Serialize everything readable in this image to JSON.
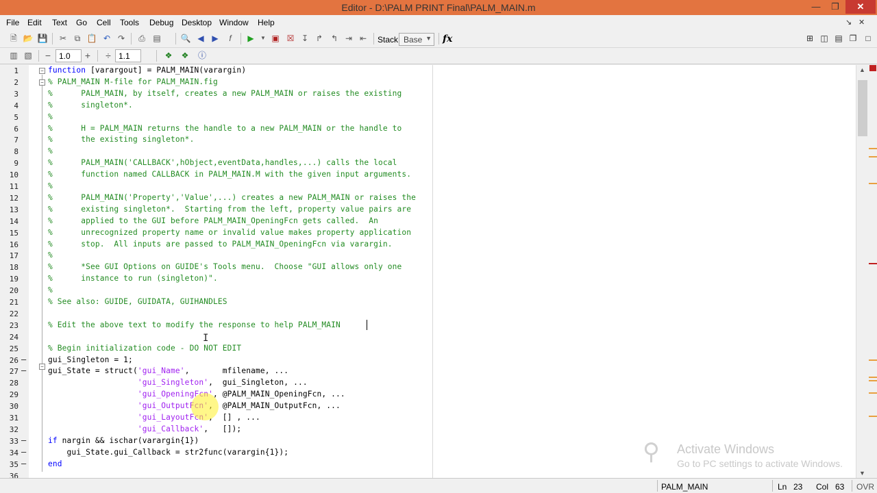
{
  "window": {
    "title": "Editor - D:\\PALM PRINT Final\\PALM_MAIN.m",
    "min_icon": "minimize-icon",
    "max_icon": "restore-icon",
    "close_icon": "close-icon"
  },
  "menubar": {
    "items": [
      "File",
      "Edit",
      "Text",
      "Go",
      "Cell",
      "Tools",
      "Debug",
      "Desktop",
      "Window",
      "Help"
    ]
  },
  "toolbar": {
    "stack_label": "Stack:",
    "stack_value": "Base",
    "fx_label": "fx",
    "cell_minus": "−",
    "cell_value": "1.0",
    "cell_plus": "+",
    "div_symbol": "÷",
    "div_value": "1.1"
  },
  "editor": {
    "lines": [
      {
        "n": "1",
        "dash": "",
        "html": "<span class='k'>function</span> [varargout] = PALM_MAIN(varargin)"
      },
      {
        "n": "2",
        "dash": "",
        "html": "<span class='c'>% PALM_MAIN M-file for PALM_MAIN.fig</span>"
      },
      {
        "n": "3",
        "dash": "",
        "html": "<span class='c'>%      PALM_MAIN, by itself, creates a new PALM_MAIN or raises the existing</span>"
      },
      {
        "n": "4",
        "dash": "",
        "html": "<span class='c'>%      singleton*.</span>"
      },
      {
        "n": "5",
        "dash": "",
        "html": "<span class='c'>%</span>"
      },
      {
        "n": "6",
        "dash": "",
        "html": "<span class='c'>%      H = PALM_MAIN returns the handle to a new PALM_MAIN or the handle to</span>"
      },
      {
        "n": "7",
        "dash": "",
        "html": "<span class='c'>%      the existing singleton*.</span>"
      },
      {
        "n": "8",
        "dash": "",
        "html": "<span class='c'>%</span>"
      },
      {
        "n": "9",
        "dash": "",
        "html": "<span class='c'>%      PALM_MAIN('CALLBACK',hObject,eventData,handles,...) calls the local</span>"
      },
      {
        "n": "10",
        "dash": "",
        "html": "<span class='c'>%      function named CALLBACK in PALM_MAIN.M with the given input arguments.</span>"
      },
      {
        "n": "11",
        "dash": "",
        "html": "<span class='c'>%</span>"
      },
      {
        "n": "12",
        "dash": "",
        "html": "<span class='c'>%      PALM_MAIN('Property','Value',...) creates a new PALM_MAIN or raises the</span>"
      },
      {
        "n": "13",
        "dash": "",
        "html": "<span class='c'>%      existing singleton*.  Starting from the left, property value pairs are</span>"
      },
      {
        "n": "14",
        "dash": "",
        "html": "<span class='c'>%      applied to the GUI before PALM_MAIN_OpeningFcn gets called.  An</span>"
      },
      {
        "n": "15",
        "dash": "",
        "html": "<span class='c'>%      unrecognized property name or invalid value makes property application</span>"
      },
      {
        "n": "16",
        "dash": "",
        "html": "<span class='c'>%      stop.  All inputs are passed to PALM_MAIN_OpeningFcn via varargin.</span>"
      },
      {
        "n": "17",
        "dash": "",
        "html": "<span class='c'>%</span>"
      },
      {
        "n": "18",
        "dash": "",
        "html": "<span class='c'>%      *See GUI Options on GUIDE's Tools menu.  Choose \"GUI allows only one</span>"
      },
      {
        "n": "19",
        "dash": "",
        "html": "<span class='c'>%      instance to run (singleton)\".</span>"
      },
      {
        "n": "20",
        "dash": "",
        "html": "<span class='c'>%</span>"
      },
      {
        "n": "21",
        "dash": "",
        "html": "<span class='c'>% See also: GUIDE, GUIDATA, GUIHANDLES</span>"
      },
      {
        "n": "22",
        "dash": "",
        "html": ""
      },
      {
        "n": "23",
        "dash": "",
        "html": "<span class='c'>% Edit the above text to modify the response to help PALM_MAIN</span>"
      },
      {
        "n": "24",
        "dash": "",
        "html": ""
      },
      {
        "n": "25",
        "dash": "",
        "html": "<span class='c'>% Begin initialization code - DO NOT EDIT</span>"
      },
      {
        "n": "26",
        "dash": "–",
        "html": "gui_Singleton = 1;"
      },
      {
        "n": "27",
        "dash": "–",
        "html": "gui_State = struct(<span class='s'>'gui_Name'</span>,       mfilename, ..."
      },
      {
        "n": "28",
        "dash": "",
        "html": "                   <span class='s'>'gui_Singleton'</span>,  gui_Singleton, ..."
      },
      {
        "n": "29",
        "dash": "",
        "html": "                   <span class='s'>'gui_OpeningFcn'</span>, @PALM_MAIN_OpeningFcn, ..."
      },
      {
        "n": "30",
        "dash": "",
        "html": "                   <span class='s'>'gui_OutputFcn'</span>,  @PALM_MAIN_OutputFcn, ..."
      },
      {
        "n": "31",
        "dash": "",
        "html": "                   <span class='s'>'gui_LayoutFcn'</span>,  [] , ..."
      },
      {
        "n": "32",
        "dash": "",
        "html": "                   <span class='s'>'gui_Callback'</span>,   []);"
      },
      {
        "n": "33",
        "dash": "–",
        "html": "<span class='k'>if</span> nargin &amp;&amp; ischar(varargin{1})"
      },
      {
        "n": "34",
        "dash": "–",
        "html": "    gui_State.gui_Callback = str2func(varargin{1});"
      },
      {
        "n": "35",
        "dash": "–",
        "html": "<span class='k'>end</span>"
      },
      {
        "n": "36",
        "dash": "",
        "html": ""
      }
    ]
  },
  "statusbar": {
    "function_name": "PALM_MAIN",
    "ln_label": "Ln",
    "ln_value": "23",
    "col_label": "Col",
    "col_value": "63",
    "mode": "OVR"
  },
  "watermark": {
    "line1": "Activate Windows",
    "line2": "Go to PC settings to activate Windows."
  }
}
